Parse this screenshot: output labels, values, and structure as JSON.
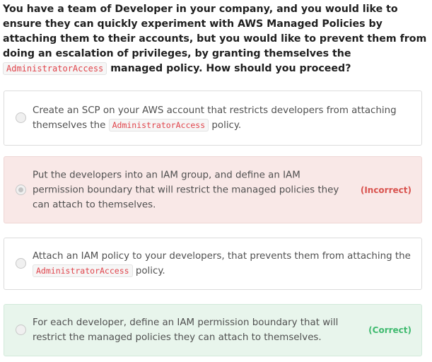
{
  "question": {
    "part1": "You have a team of Developer in your company, and you would like to ensure they can quickly experiment with AWS Managed Policies by attaching them to their accounts, but you would like to prevent them from doing an escalation of privileges, by granting themselves the ",
    "code": "AdministratorAccess",
    "part2": " managed policy. How should you proceed?"
  },
  "options": [
    {
      "text_before": "Create an SCP on your AWS account that restricts developers from attaching themselves the ",
      "code": "AdministratorAccess",
      "text_after": " policy.",
      "selected": false,
      "status": ""
    },
    {
      "text": "Put the developers into an IAM group, and define an IAM permission boundary that will restrict the managed policies they can attach to themselves.",
      "selected": true,
      "status": "(Incorrect)"
    },
    {
      "text_before": "Attach an IAM policy to your developers, that prevents them from attaching the ",
      "code": "AdministratorAccess",
      "text_after": " policy.",
      "selected": false,
      "status": ""
    },
    {
      "text": "For each developer, define an IAM permission boundary that will restrict the managed policies they can attach to themselves.",
      "selected": false,
      "status": "(Correct)"
    }
  ],
  "colors": {
    "incorrect_bg": "#f9e8e7",
    "correct_bg": "#e8f5ec",
    "incorrect_text": "#d9534f",
    "correct_text": "#3fba6f",
    "code_text": "#e0444b"
  }
}
